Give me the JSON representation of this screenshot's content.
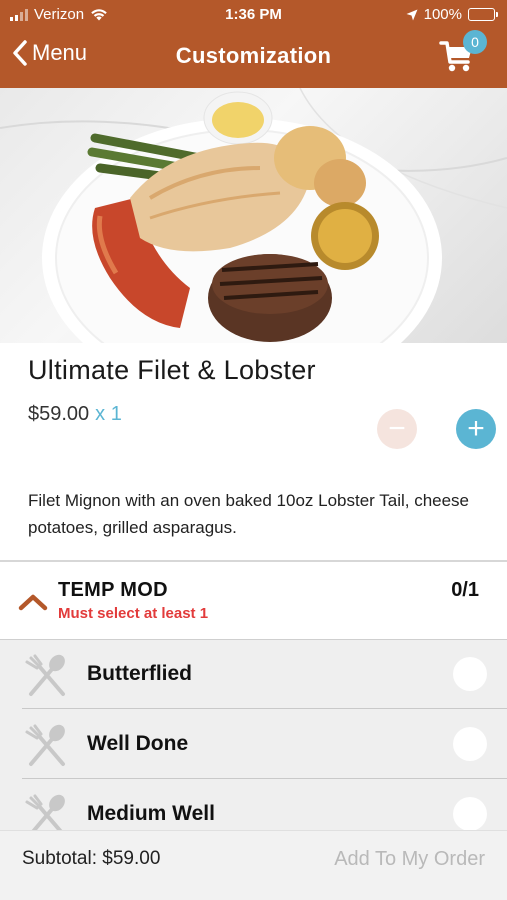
{
  "status_bar": {
    "carrier": "Verizon",
    "time": "1:36 PM",
    "battery": "100%",
    "icons": [
      "signal-icon",
      "wifi-icon",
      "location-arrow-icon",
      "battery-icon"
    ]
  },
  "nav": {
    "back_label": "Menu",
    "title": "Customization",
    "cart_count": "0"
  },
  "item": {
    "name": "Ultimate Filet & Lobster",
    "price": "$59.00",
    "quantity": "x 1",
    "minus": "−",
    "plus": "+",
    "description": "Filet Mignon with an oven baked 10oz Lobster Tail, cheese potatoes, grilled asparagus."
  },
  "modifier_group": {
    "title": "TEMP MOD",
    "requirement": "Must select at least 1",
    "count": "0/1",
    "options": [
      {
        "label": "Butterflied",
        "selected": false
      },
      {
        "label": "Well Done",
        "selected": false
      },
      {
        "label": "Medium Well",
        "selected": false
      }
    ]
  },
  "footer": {
    "subtotal": "Subtotal: $59.00",
    "add_button": "Add To My Order"
  },
  "colors": {
    "header": "#b4582a",
    "accent": "#5bb5d3",
    "warning": "#e23b3b",
    "minus_disabled": "#f5e4de"
  }
}
